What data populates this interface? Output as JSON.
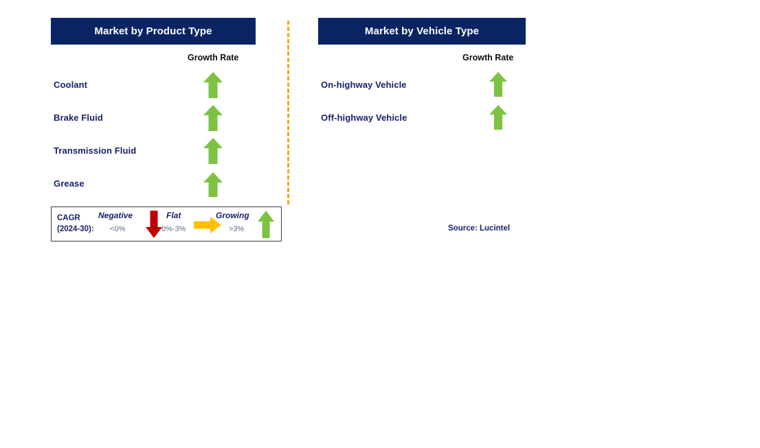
{
  "panels": [
    {
      "id": "product-type",
      "title": "Market by Product Type",
      "growth_rate_label": "Growth Rate",
      "rows": [
        {
          "label": "Coolant",
          "trend": "growing",
          "trend_icon": "arrow-up-icon"
        },
        {
          "label": "Brake Fluid",
          "trend": "growing",
          "trend_icon": "arrow-up-icon"
        },
        {
          "label": "Transmission Fluid",
          "trend": "growing",
          "trend_icon": "arrow-up-icon"
        },
        {
          "label": "Grease",
          "trend": "growing",
          "trend_icon": "arrow-up-icon"
        }
      ]
    },
    {
      "id": "vehicle-type",
      "title": "Market by Vehicle Type",
      "growth_rate_label": "Growth Rate",
      "rows": [
        {
          "label": "On-highway Vehicle",
          "trend": "growing",
          "trend_icon": "arrow-up-icon"
        },
        {
          "label": "Off-highway Vehicle",
          "trend": "growing",
          "trend_icon": "arrow-up-icon"
        }
      ]
    }
  ],
  "legend": {
    "cagr_line1": "CAGR",
    "cagr_line2": "(2024-30):",
    "items": [
      {
        "title": "Negative",
        "range": "<0%",
        "icon": "arrow-down-icon",
        "color": "#C00000"
      },
      {
        "title": "Flat",
        "range": "0%-3%",
        "icon": "arrow-right-icon",
        "color": "#FFC000"
      },
      {
        "title": "Growing",
        "range": ">3%",
        "icon": "arrow-up-icon",
        "color": "#7DC242"
      }
    ]
  },
  "source": "Source: Lucintel",
  "colors": {
    "header_navy": "#0A2463",
    "label_navy": "#16216B",
    "growing_green": "#7DC242",
    "negative_red": "#C00000",
    "flat_yellow": "#FFC000",
    "divider_orange": "#F2A900",
    "range_text": "#5A6B8C"
  }
}
